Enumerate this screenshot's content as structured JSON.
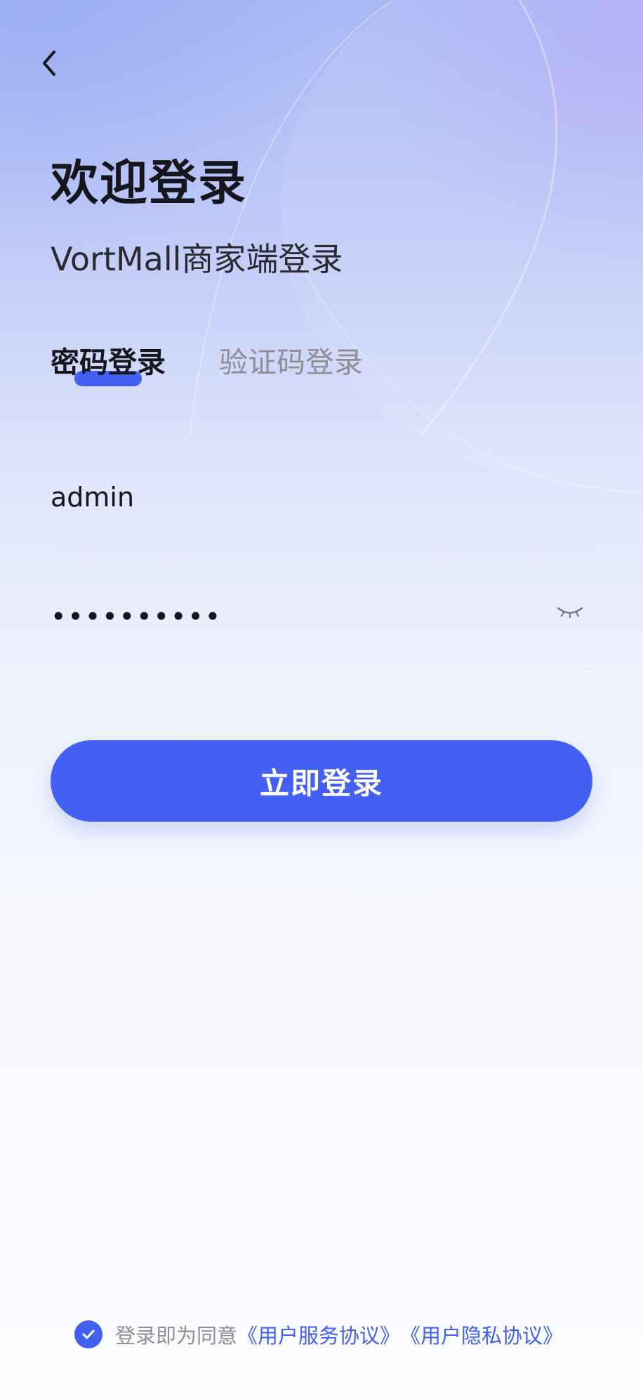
{
  "header": {
    "back_icon": "chevron-left-icon",
    "title": "欢迎登录",
    "subtitle": "VortMall商家端登录"
  },
  "tabs": [
    {
      "label": "密码登录",
      "active": true
    },
    {
      "label": "验证码登录",
      "active": false
    }
  ],
  "form": {
    "username_value": "admin",
    "password_value": "••••••••••",
    "password_toggle_icon": "eye-closed-icon",
    "submit_label": "立即登录"
  },
  "agreement": {
    "checked": true,
    "checkbox_icon": "check-icon",
    "text": "登录即为同意",
    "terms_link": "《用户服务协议》",
    "privacy_link": "《用户隐私协议》"
  },
  "colors": {
    "accent": "#4460f3",
    "title_text": "#16161c",
    "muted_text": "#8e8e94"
  }
}
